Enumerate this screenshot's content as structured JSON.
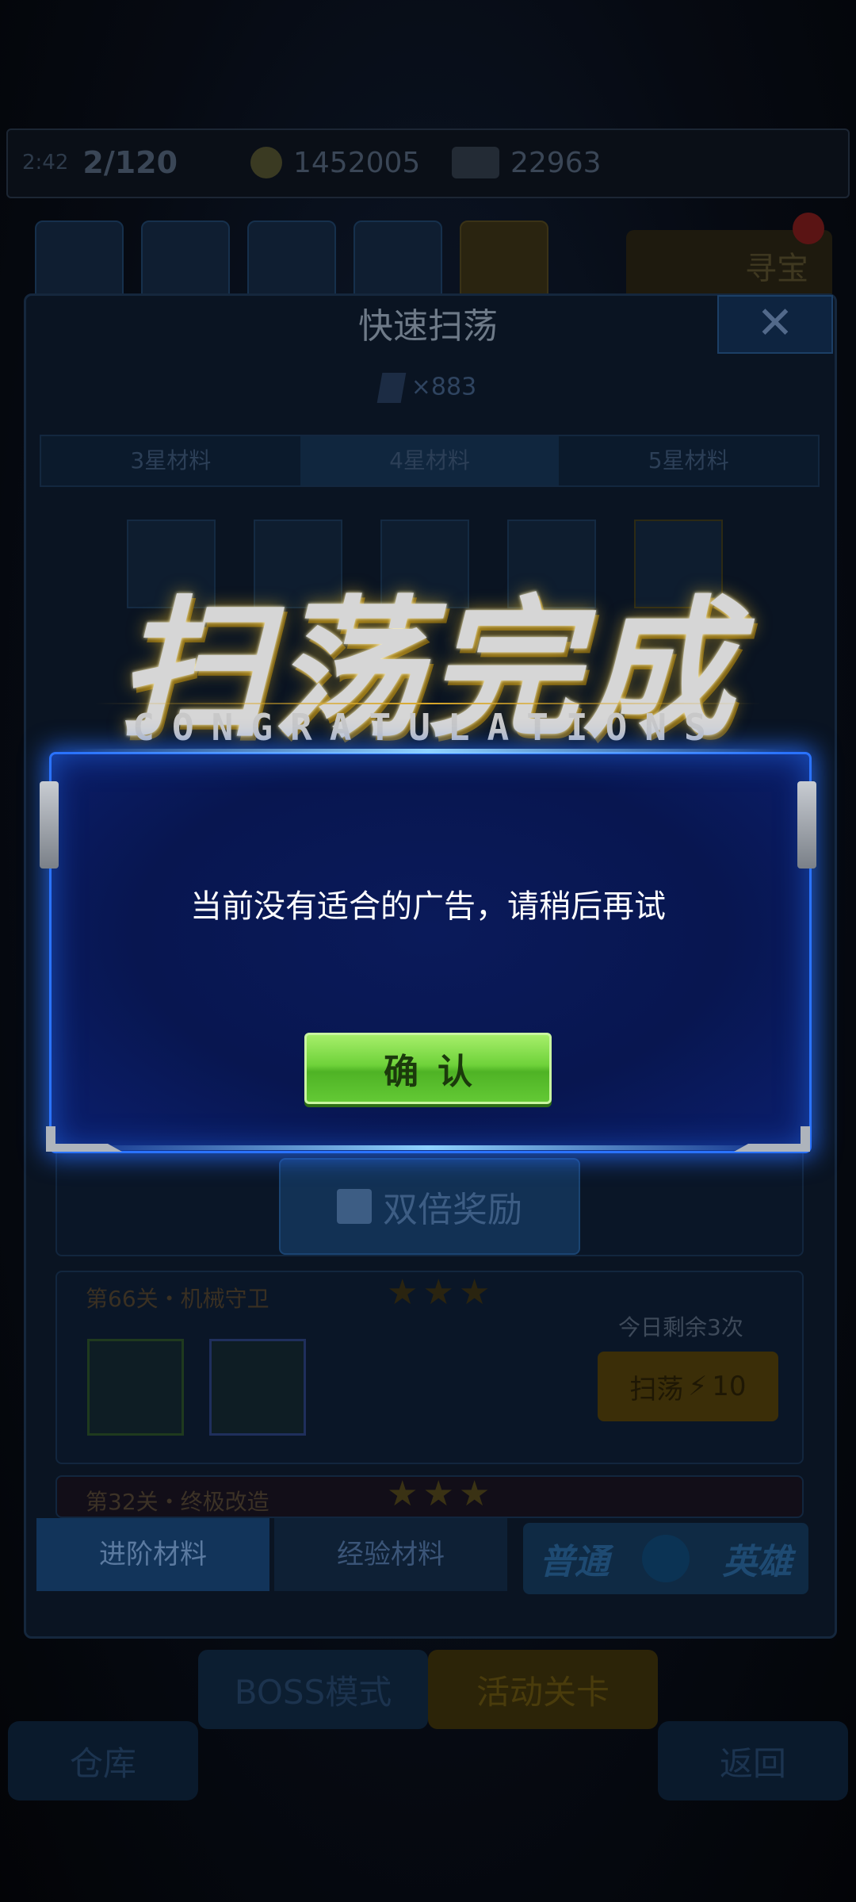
{
  "top_bar": {
    "level_time": "2:42",
    "stamina": "2/120",
    "gold": "1452005",
    "gems": "22963"
  },
  "nav": {
    "treasure_label": "寻宝"
  },
  "panel": {
    "title": "快速扫荡",
    "close_symbol": "✕",
    "ticket_count": "×883",
    "star_tabs": [
      "3星材料",
      "4星材料",
      "5星材料"
    ],
    "active_star_tab": "4星材料",
    "double_reward_label": "双倍奖励",
    "stage_66": {
      "name": "第66关・机械守卫",
      "stars": "★★★",
      "remaining": "今日剩余3次",
      "sweep_label": "扫荡",
      "sweep_cost": "10"
    },
    "stage_32": {
      "name": "第32关・终极改造",
      "stars": "★★★"
    },
    "material_tabs": [
      "进阶材料",
      "经验材料"
    ],
    "mode_left": "普通",
    "mode_right": "英雄"
  },
  "bottom": {
    "boss_mode": "BOSS模式",
    "event_stage": "活动关卡",
    "warehouse": "仓库",
    "back": "返回"
  },
  "banner": {
    "title": "扫荡完成",
    "subtitle": "CONGRATULATIONS"
  },
  "dialog": {
    "message": "当前没有适合的广告，请稍后再试",
    "confirm_label": "确认"
  },
  "colors": {
    "dialog_border": "#2a73ff",
    "dialog_bg": "#081650",
    "confirm_green": "#6fd23a"
  }
}
